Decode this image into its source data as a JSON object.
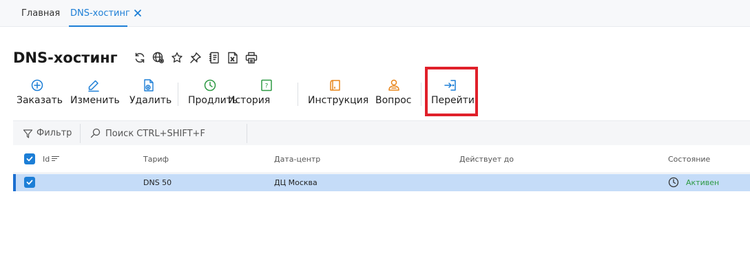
{
  "tabs": {
    "home": "Главная",
    "dns": "DNS-хостинг"
  },
  "page": {
    "title": "DNS-хостинг"
  },
  "title_icons": [
    "refresh-icon",
    "globe-settings-icon",
    "star-icon",
    "pin-icon",
    "notebook-icon",
    "excel-export-icon",
    "print-icon"
  ],
  "toolbar": {
    "order": "Заказать",
    "edit": "Изменить",
    "delete": "Удалить",
    "renew": "Продлить",
    "history": "История",
    "instruction": "Инструкция",
    "question": "Вопрос",
    "goto": "Перейти"
  },
  "filterbar": {
    "filter_label": "Фильтр",
    "search_placeholder": "Поиск CTRL+SHIFT+F"
  },
  "table": {
    "columns": {
      "id": "Id",
      "tariff": "Тариф",
      "datacenter": "Дата-центр",
      "valid_until": "Действует до",
      "status": "Состояние"
    },
    "rows": [
      {
        "id": "",
        "tariff": "DNS 50",
        "datacenter": "ДЦ Москва",
        "valid_until": "",
        "status": "Активен"
      }
    ]
  },
  "colors": {
    "accent": "#1c7ed6",
    "highlight": "#e0202a",
    "selected_row": "#c5dcf8",
    "status_active": "#2e9a44",
    "icon_green": "#2e9a44",
    "icon_orange": "#e8851a"
  }
}
